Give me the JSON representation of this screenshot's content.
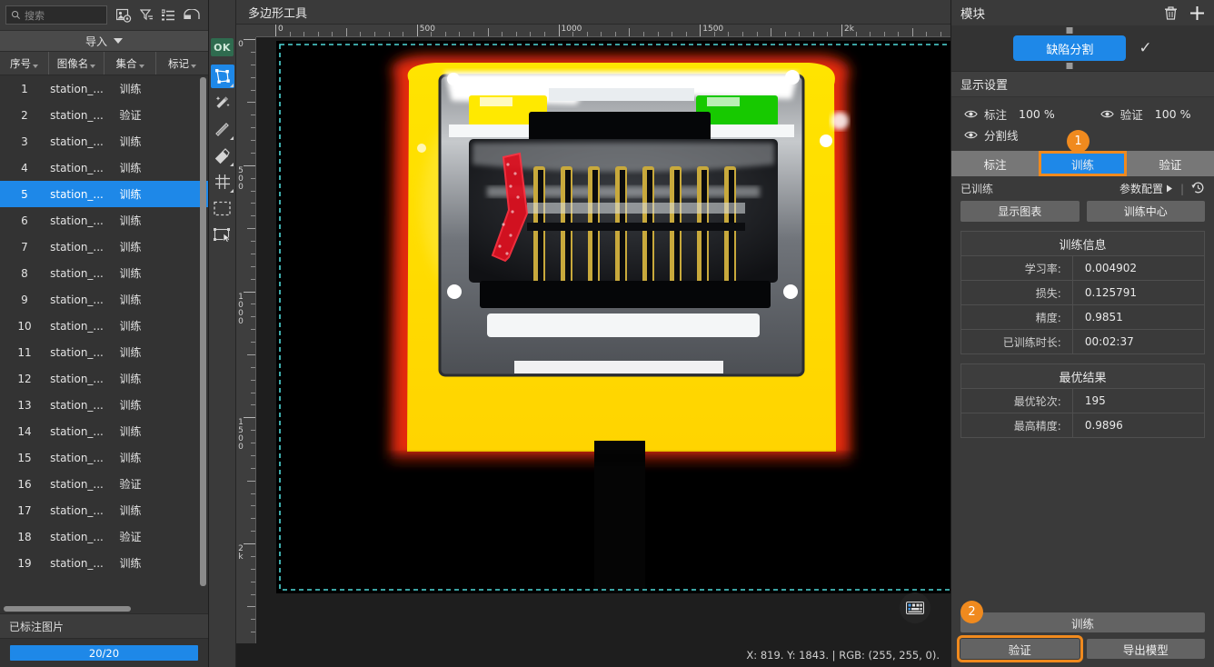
{
  "left_panel": {
    "search": {
      "placeholder": "搜索",
      "icon": "search-icon"
    },
    "header_icons": [
      "image-settings-icon",
      "filter-icon",
      "list-view-icon",
      "panel-layout-icon"
    ],
    "import_label": "导入",
    "columns": [
      "序号",
      "图像名",
      "集合",
      "标记"
    ],
    "rows": [
      {
        "no": "1",
        "name": "station_...",
        "set": "训练",
        "mark": ""
      },
      {
        "no": "2",
        "name": "station_...",
        "set": "验证",
        "mark": ""
      },
      {
        "no": "3",
        "name": "station_...",
        "set": "训练",
        "mark": ""
      },
      {
        "no": "4",
        "name": "station_...",
        "set": "训练",
        "mark": ""
      },
      {
        "no": "5",
        "name": "station_...",
        "set": "训练",
        "mark": ""
      },
      {
        "no": "6",
        "name": "station_...",
        "set": "训练",
        "mark": ""
      },
      {
        "no": "7",
        "name": "station_...",
        "set": "训练",
        "mark": ""
      },
      {
        "no": "8",
        "name": "station_...",
        "set": "训练",
        "mark": ""
      },
      {
        "no": "9",
        "name": "station_...",
        "set": "训练",
        "mark": ""
      },
      {
        "no": "10",
        "name": "station_...",
        "set": "训练",
        "mark": ""
      },
      {
        "no": "11",
        "name": "station_...",
        "set": "训练",
        "mark": ""
      },
      {
        "no": "12",
        "name": "station_...",
        "set": "训练",
        "mark": ""
      },
      {
        "no": "13",
        "name": "station_...",
        "set": "训练",
        "mark": ""
      },
      {
        "no": "14",
        "name": "station_...",
        "set": "训练",
        "mark": ""
      },
      {
        "no": "15",
        "name": "station_...",
        "set": "训练",
        "mark": ""
      },
      {
        "no": "16",
        "name": "station_...",
        "set": "验证",
        "mark": ""
      },
      {
        "no": "17",
        "name": "station_...",
        "set": "训练",
        "mark": ""
      },
      {
        "no": "18",
        "name": "station_...",
        "set": "验证",
        "mark": ""
      },
      {
        "no": "19",
        "name": "station_...",
        "set": "训练",
        "mark": ""
      }
    ],
    "selected_row_index": 4,
    "labeled_section_title": "已标注图片",
    "labeled_progress_text": "20/20"
  },
  "toolbar": {
    "ok_label": "OK",
    "tools": [
      "polygon-tool-icon",
      "magic-wand-tool-icon",
      "shape-fill-tool-icon",
      "eraser-tool-icon",
      "grid-tool-icon",
      "marquee-select-tool-icon",
      "transform-tool-icon"
    ],
    "active_tool_index": 0
  },
  "center": {
    "title": "多边形工具",
    "h_ruler_labels": [
      "0",
      "500",
      "1000",
      "1500",
      "2k"
    ],
    "v_ruler_labels": [
      "0",
      "500",
      "1000",
      "1500",
      "2k"
    ],
    "status_text": "X: 819. Y: 1843. | RGB: (255, 255, 0).",
    "keyboard_help_icon": "keyboard-icon"
  },
  "right_panel": {
    "header_title": "模块",
    "header_icons": [
      "trash-icon",
      "plus-icon"
    ],
    "module_name": "缺陷分割",
    "module_check_icon": "check-icon",
    "display_settings_title": "显示设置",
    "display_rows": [
      {
        "label": "标注",
        "value": "100 %"
      },
      {
        "label": "验证",
        "value": "100 %"
      },
      {
        "label": "分割线",
        "value": ""
      }
    ],
    "tabs": [
      {
        "label": "标注",
        "active": false
      },
      {
        "label": "训练",
        "active": true
      },
      {
        "label": "验证",
        "active": false
      }
    ],
    "badges": [
      {
        "text": "1"
      },
      {
        "text": "2"
      }
    ],
    "trained_status": "已训练",
    "param_config_label": "参数配置",
    "history_icon": "history-icon",
    "action_buttons": [
      "显示图表",
      "训练中心"
    ],
    "tables": [
      {
        "title": "训练信息",
        "rows": [
          {
            "key": "学习率:",
            "value": "0.004902"
          },
          {
            "key": "损失:",
            "value": "0.125791"
          },
          {
            "key": "精度:",
            "value": "0.9851"
          },
          {
            "key": "已训练时长:",
            "value": "00:02:37"
          }
        ]
      },
      {
        "title": "最优结果",
        "rows": [
          {
            "key": "最优轮次:",
            "value": "195"
          },
          {
            "key": "最高精度:",
            "value": "0.9896"
          }
        ]
      }
    ],
    "bottom": {
      "train_label": "训练",
      "validate_label": "验证",
      "export_label": "导出模型"
    }
  },
  "colors": {
    "accent_blue": "#1e88e8",
    "highlight_orange": "#f08a1e",
    "panel_bg": "#3a3a3a",
    "list_bg": "#333333"
  }
}
